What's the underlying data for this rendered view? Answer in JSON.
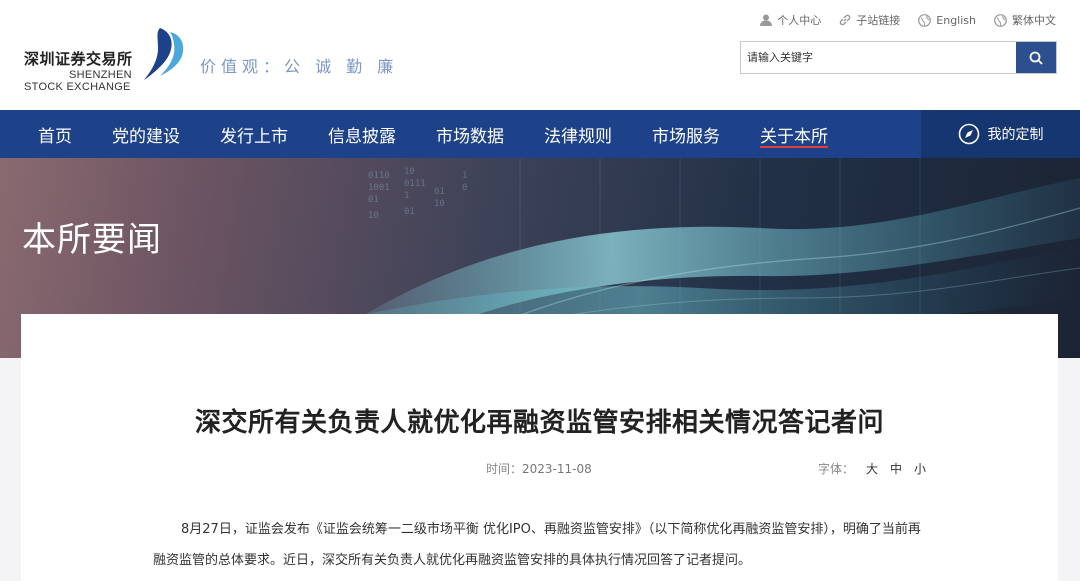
{
  "header": {
    "logo": {
      "name_cn": "深圳证券交易所",
      "name_en_line1": "SHENZHEN",
      "name_en_line2": "STOCK EXCHANGE"
    },
    "slogan": "价值观：公 诚 勤 廉",
    "top_links": [
      {
        "label": "个人中心",
        "icon": "user-icon"
      },
      {
        "label": "子站链接",
        "icon": "link-icon"
      },
      {
        "label": "English",
        "icon": "globe-icon"
      },
      {
        "label": "繁体中文",
        "icon": "globe-icon"
      }
    ],
    "search": {
      "placeholder": "请输入关键字",
      "button_icon": "search-icon"
    }
  },
  "nav": {
    "items": [
      {
        "label": "首页"
      },
      {
        "label": "党的建设"
      },
      {
        "label": "发行上市"
      },
      {
        "label": "信息披露"
      },
      {
        "label": "市场数据"
      },
      {
        "label": "法律规则"
      },
      {
        "label": "市场服务"
      },
      {
        "label": "关于本所",
        "active": true
      }
    ],
    "custom": {
      "label": "我的定制",
      "icon": "compass-icon"
    }
  },
  "banner": {
    "title": "本所要闻"
  },
  "article": {
    "title": "深交所有关负责人就优化再融资监管安排相关情况答记者问",
    "time_label": "时间：",
    "time_value": "2023-11-08",
    "font_size_label": "字体：",
    "font_sizes": [
      "大",
      "中",
      "小"
    ],
    "paragraph": "8月27日，证监会发布《证监会统筹一二级市场平衡 优化IPO、再融资监管安排》（以下简称优化再融资监管安排），明确了当前再融资监管的总体要求。近日，深交所有关负责人就优化再融资监管安排的具体执行情况回答了记者提问。"
  },
  "colors": {
    "nav_bg": "#1d4289",
    "nav_active_underline": "#e23c3c",
    "search_button": "#2d4f8e",
    "slogan": "#7d97c7"
  }
}
